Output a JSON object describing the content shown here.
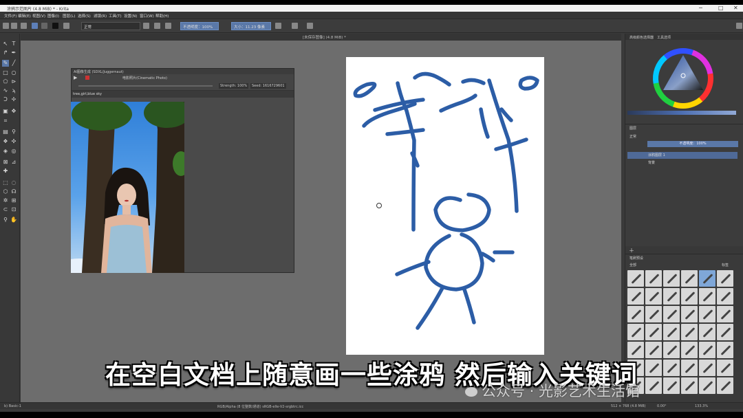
{
  "window": {
    "title": "涂鸦示范图片 (4.8 MiB) * - Krita"
  },
  "menu": [
    "文件(F)",
    "编辑(E)",
    "视图(V)",
    "图像(I)",
    "图层(L)",
    "选择(S)",
    "滤镜(R)",
    "工具(T)",
    "设置(N)",
    "窗口(W)",
    "帮助(H)"
  ],
  "toolbar": {
    "blend_mode": "正常",
    "opacity_label": "不透明度：100%",
    "size_label": "大小：11.23 像素"
  },
  "document_tab": "[未保存图像] (4.8 MiB) *",
  "ai_docker": {
    "title": "AI图像生成 (SDXL/Juggernaut)",
    "style": "电影照片(Cinematic Photo)",
    "strength": "Strength: 100%",
    "seed": "Seed: 1616729601",
    "prompt": "tree,girl,blue sky"
  },
  "right_panel": {
    "tab_color": "高级颜色选择器",
    "tab_tool": "工具选项",
    "layers_title": "图层",
    "layers_filter": "正常",
    "layer_opacity": "不透明度：100%",
    "layers": [
      {
        "name": "涂鸦图层 1",
        "selected": true
      },
      {
        "name": "背景",
        "selected": false
      }
    ],
    "brushes_title": "笔刷预设",
    "brushes_filter": "全部",
    "brushes_tag": "标签"
  },
  "status": {
    "brush": "b) Basic-1",
    "color_space": "RGB/Alpha (8 位整数/通道)  sRGB-elle-V2-srgbtrc.icc",
    "dims": "512 × 768 (4.8 MiB)",
    "rotation": "0.00°",
    "zoom": "133.3%"
  },
  "subtitle": "在空白文档上随意画一些涂鸦 然后输入关键词",
  "watermark": "公众号 · 光影艺术生活馆",
  "colors": {
    "stroke": "#2c5da6",
    "accent": "#5a78a8"
  }
}
